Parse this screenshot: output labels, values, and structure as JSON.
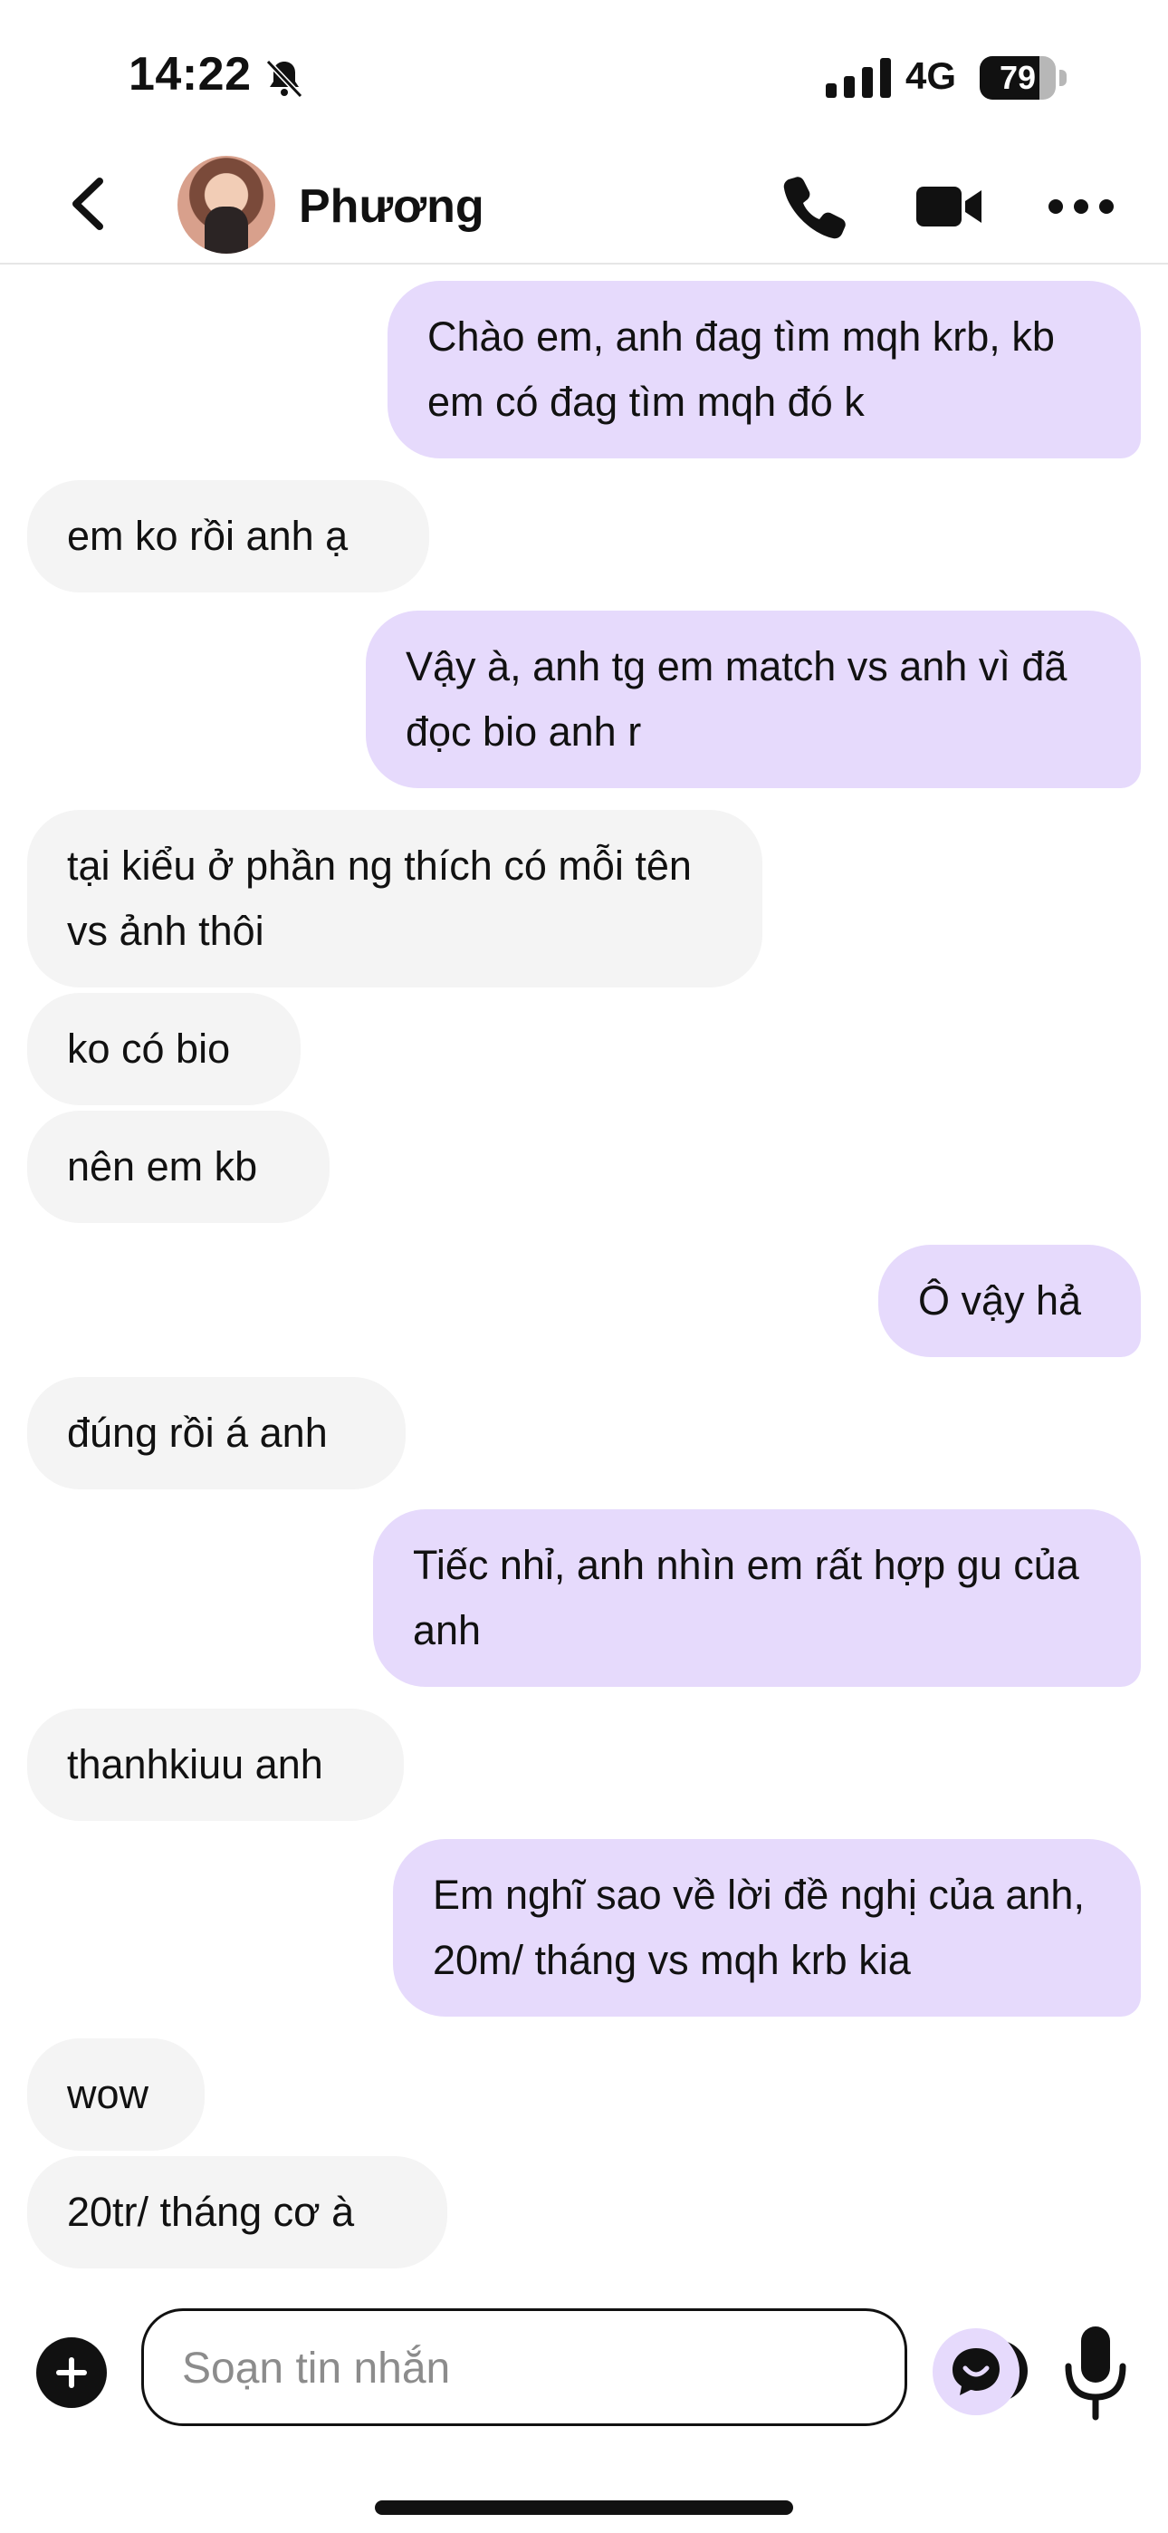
{
  "status_bar": {
    "time": "14:22",
    "network": "4G",
    "battery": "79",
    "battery_level": 0.79
  },
  "header": {
    "contact_name": "Phương"
  },
  "messages": [
    {
      "from": "me",
      "text": "Chào em, anh đag tìm mqh krb, kb em có đag tìm mqh đó k"
    },
    {
      "from": "them",
      "text": "em ko rồi anh ạ"
    },
    {
      "from": "me",
      "text": "Vậy à, anh tg em match vs anh vì đã đọc bio anh r"
    },
    {
      "from": "them",
      "text": "tại kiểu ở phần ng thích có mỗi tên vs ảnh thôi"
    },
    {
      "from": "them",
      "text": "ko có bio"
    },
    {
      "from": "them",
      "text": "nên em kb"
    },
    {
      "from": "me",
      "text": "Ô vậy hả"
    },
    {
      "from": "them",
      "text": "đúng rồi á anh"
    },
    {
      "from": "me",
      "text": "Tiếc nhỉ, anh nhìn em rất hợp gu của anh"
    },
    {
      "from": "them",
      "text": "thanhkiuu anh"
    },
    {
      "from": "me",
      "text": "Em nghĩ sao về lời đề nghị của anh, 20m/ tháng vs mqh krb kia"
    },
    {
      "from": "them",
      "text": "wow"
    },
    {
      "from": "them",
      "text": "20tr/ tháng cơ à"
    }
  ],
  "composer": {
    "placeholder": "Soạn tin nhắn"
  },
  "colors": {
    "outgoing_bubble": "#e6dafc",
    "incoming_bubble": "#f4f4f4",
    "text": "#111111"
  },
  "icons": [
    "bell-off-icon",
    "signal-icon",
    "battery-icon",
    "back-icon",
    "phone-icon",
    "video-icon",
    "more-icon",
    "plus-icon",
    "emoji-icon",
    "gif-icon",
    "mic-icon"
  ]
}
